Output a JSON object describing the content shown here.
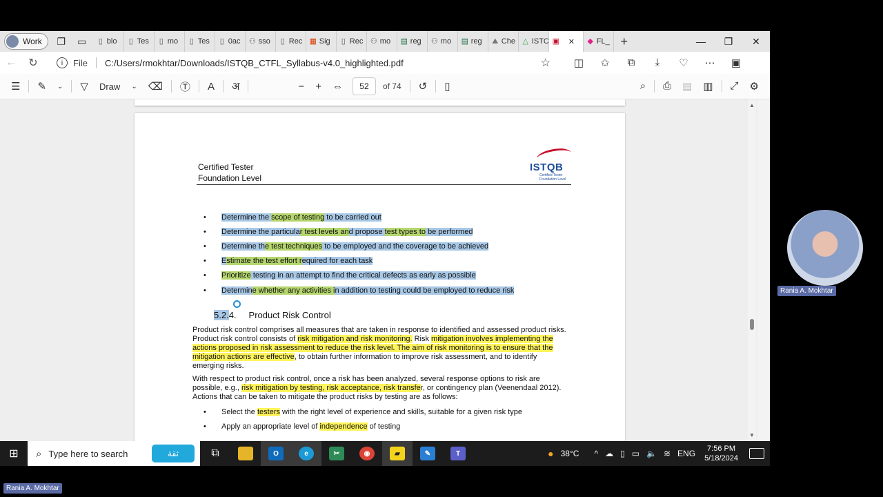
{
  "browser": {
    "profile_label": "Work",
    "tabs": [
      {
        "label": "blo",
        "icon": "doc"
      },
      {
        "label": "Tes",
        "icon": "doc"
      },
      {
        "label": "mo",
        "icon": "doc"
      },
      {
        "label": "Tes",
        "icon": "doc"
      },
      {
        "label": "0ac",
        "icon": "doc"
      },
      {
        "label": "sso",
        "icon": "puzzle"
      },
      {
        "label": "Rec",
        "icon": "doc"
      },
      {
        "label": "Sig",
        "icon": "ms"
      },
      {
        "label": "Rec",
        "icon": "doc"
      },
      {
        "label": "mo",
        "icon": "puzzle"
      },
      {
        "label": "reg",
        "icon": "excel"
      },
      {
        "label": "mo",
        "icon": "puzzle"
      },
      {
        "label": "reg",
        "icon": "excel"
      },
      {
        "label": "Che",
        "icon": "dev"
      },
      {
        "label": "ISTC",
        "icon": "drive"
      },
      {
        "label": "",
        "icon": "pdf",
        "active": true
      },
      {
        "label": "FL_",
        "icon": "pink"
      }
    ],
    "address": {
      "scheme_label": "File",
      "url": "C:/Users/rmokhtar/Downloads/ISTQB_CTFL_Syllabus-v4.0_highlighted.pdf"
    }
  },
  "pdf_toolbar": {
    "draw_label": "Draw",
    "page_number": "52",
    "page_total": "of 74"
  },
  "document": {
    "header_line1": "Certified Tester",
    "header_line2": "Foundation Level",
    "logo_text": "ISTQB",
    "logo_sub": "Certified Tester Foundation Level",
    "bullets": [
      {
        "segments": [
          [
            "Determine the ",
            "b"
          ],
          [
            "scope of testing",
            "g"
          ],
          [
            " to be carried out",
            "b"
          ]
        ]
      },
      {
        "segments": [
          [
            "Determine the particula",
            "b"
          ],
          [
            "r test levels an",
            "g"
          ],
          [
            "d propose ",
            "b"
          ],
          [
            "test types to",
            "g"
          ],
          [
            " be performed",
            "b"
          ]
        ]
      },
      {
        "segments": [
          [
            "Determine th",
            "b"
          ],
          [
            "e test techniques",
            "g"
          ],
          [
            " to be employed and the coverage to be achieved",
            "b"
          ]
        ]
      },
      {
        "segments": [
          [
            "E",
            "b"
          ],
          [
            "stimate the test effort r",
            "g"
          ],
          [
            "equired for each task",
            "b"
          ]
        ]
      },
      {
        "segments": [
          [
            "Prioritize",
            "g"
          ],
          [
            " testing in an attempt to find the critical defects as early as possible",
            "b"
          ]
        ]
      },
      {
        "segments": [
          [
            "Determin",
            "b"
          ],
          [
            "e whether any activities i",
            "g"
          ],
          [
            "n addition to testing could be employed to reduce risk",
            "b"
          ]
        ]
      }
    ],
    "section_number_hl": "5.2.",
    "section_number_rest": "4.",
    "section_title": "Product Risk Control",
    "para1": [
      [
        "Product risk control comprises all measures that are taken in response to identified and assessed product risks. Product risk control consists of ",
        ""
      ],
      [
        "risk mitigation and risk monitoring.",
        "y"
      ],
      [
        " Risk ",
        ""
      ],
      [
        "mitigation involves implementing the actions proposed in risk assessment to reduce the risk level. The aim of risk monitoring is to ensure that the mitigation actions are effective",
        "y"
      ],
      [
        ", to obtain further information to improve risk assessment, and to identify emerging risks.",
        ""
      ]
    ],
    "para2": [
      [
        "With respect to product risk control, once a risk has been analyzed, several response options to risk are possible, e.g., ",
        ""
      ],
      [
        "risk mitigation by testing, risk acceptance, risk transfe",
        "y"
      ],
      [
        "r, or contingency plan (Veenendaal 2012). Actions that can be taken to mitigate the product risks by testing are as follows:",
        ""
      ]
    ],
    "bullets2": [
      {
        "segments": [
          [
            "Select the ",
            ""
          ],
          [
            "testers",
            "y"
          ],
          [
            " with the right level of experience and skills, suitable for a given risk type",
            ""
          ]
        ]
      },
      {
        "segments": [
          [
            "Apply an appropriate level of ",
            ""
          ],
          [
            "independence",
            "y"
          ],
          [
            " of testing",
            ""
          ]
        ]
      }
    ]
  },
  "video": {
    "participant_name": "Rania A. Mokhtar",
    "self_name": "Rania A. Mokhtar"
  },
  "taskbar": {
    "search_placeholder": "Type here to search",
    "thiqa_label": "ثقة",
    "temperature": "38°C",
    "language": "ENG",
    "time": "7:56 PM",
    "date": "5/18/2024"
  }
}
